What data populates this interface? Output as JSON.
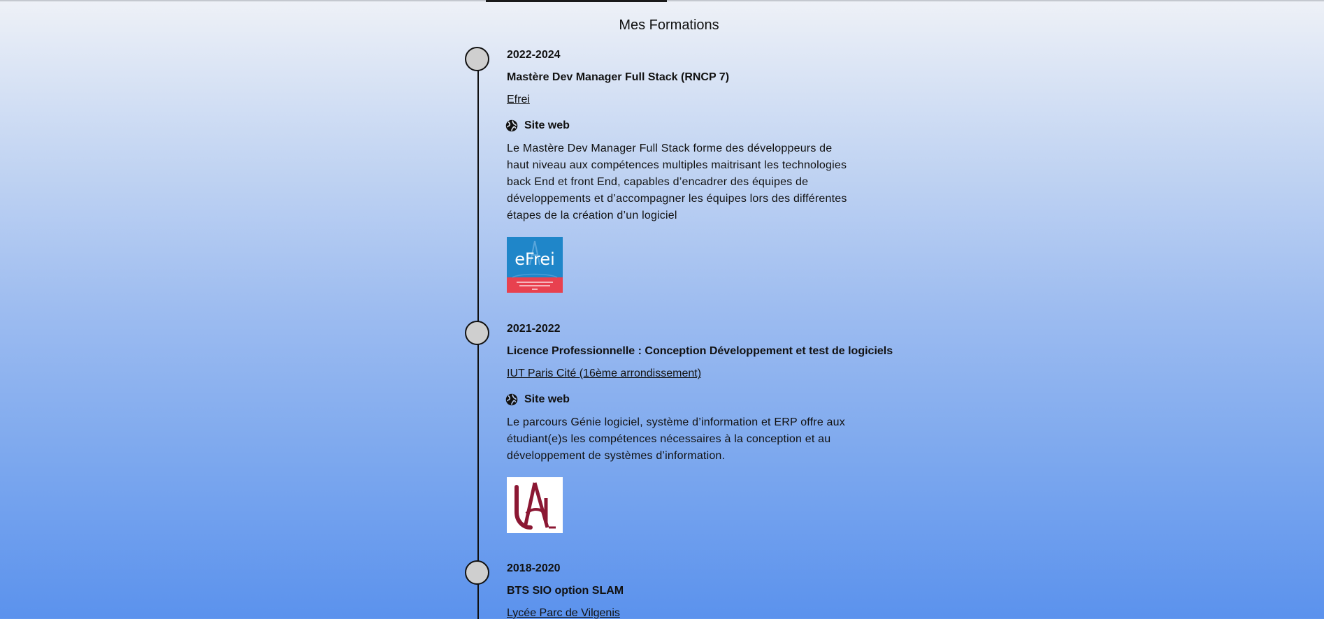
{
  "page": {
    "title": "Mes Formations"
  },
  "formations": [
    {
      "years": "2022-2024",
      "degree": "Mastère Dev Manager Full Stack (RNCP 7)",
      "school": "Efrei",
      "site_label": "Site web",
      "description": "Le Mastère Dev Manager Full Stack forme des développeurs de haut niveau aux compétences multiples maitrisant les technologies back End et front End, capables d’encadrer des équipes de développements et d’accompagner les équipes lors des différentes étapes de la création d’un logiciel",
      "logo_text": "eFrei",
      "logo_icon": "efrei-logo"
    },
    {
      "years": "2021-2022",
      "degree": "Licence Professionnelle : Conception Développement et test de logiciels",
      "school": "IUT Paris Cité (16ème arrondissement)",
      "site_label": "Site web",
      "description": "Le parcours Génie logiciel, système d’information et ERP offre aux étudiant(e)s les compétences nécessaires à la conception et au développement de systèmes d’information.",
      "logo_icon": "universite-paris-cite-logo"
    },
    {
      "years": "2018-2020",
      "degree": "BTS SIO option SLAM",
      "school": "Lycée Parc de Vilgenis"
    }
  ],
  "colors": {
    "background_top": "#eef1f7",
    "background_bottom": "#5b92ed",
    "dot_fill": "#cfcfcf",
    "efrei_blue": "#1f86c9",
    "efrei_red": "#e8414f",
    "upc_red": "#8b1733"
  }
}
